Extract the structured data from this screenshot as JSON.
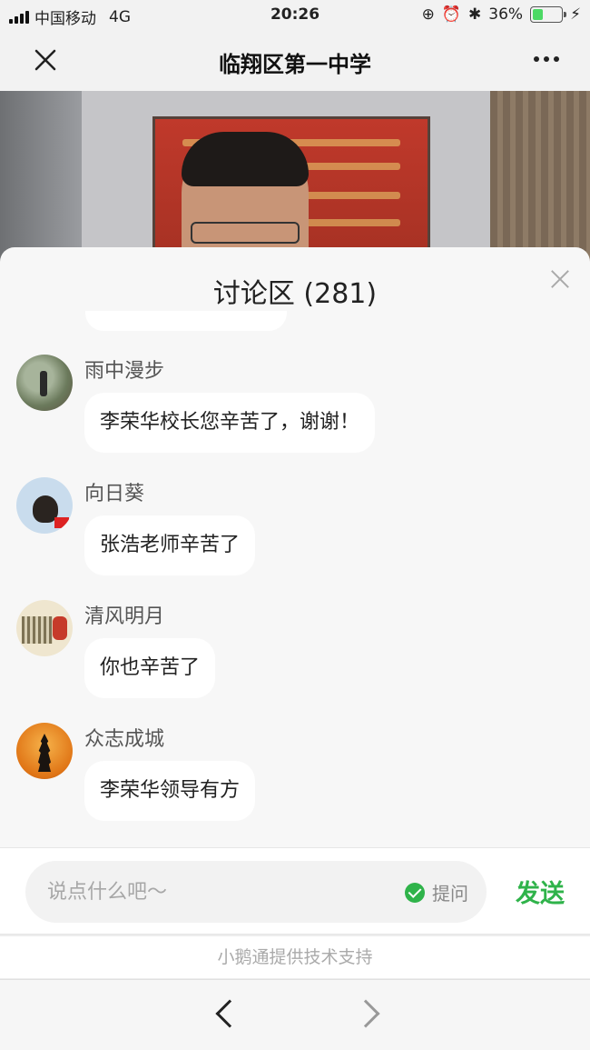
{
  "status_bar": {
    "carrier": "中国移动",
    "network": "4G",
    "time": "20:26",
    "battery_percent": "36%",
    "battery_level": 0.36
  },
  "nav": {
    "title": "临翔区第一中学",
    "close_icon": "close-icon",
    "more_icon": "more-icon"
  },
  "discussion": {
    "title": "讨论区 (281)",
    "messages": [
      {
        "name": "雨中漫步",
        "text": "李荣华校长您辛苦了，谢谢！"
      },
      {
        "name": "向日葵",
        "text": "张浩老师辛苦了"
      },
      {
        "name": "清风明月",
        "text": "你也辛苦了"
      },
      {
        "name": "众志成城",
        "text": "李荣华领导有方"
      }
    ]
  },
  "composer": {
    "placeholder": "说点什么吧～",
    "ask_label": "提问",
    "send_label": "发送"
  },
  "footer": {
    "credit": "小鹅通提供技术支持"
  },
  "colors": {
    "accent": "#2fb34a",
    "battery": "#4cd964"
  }
}
